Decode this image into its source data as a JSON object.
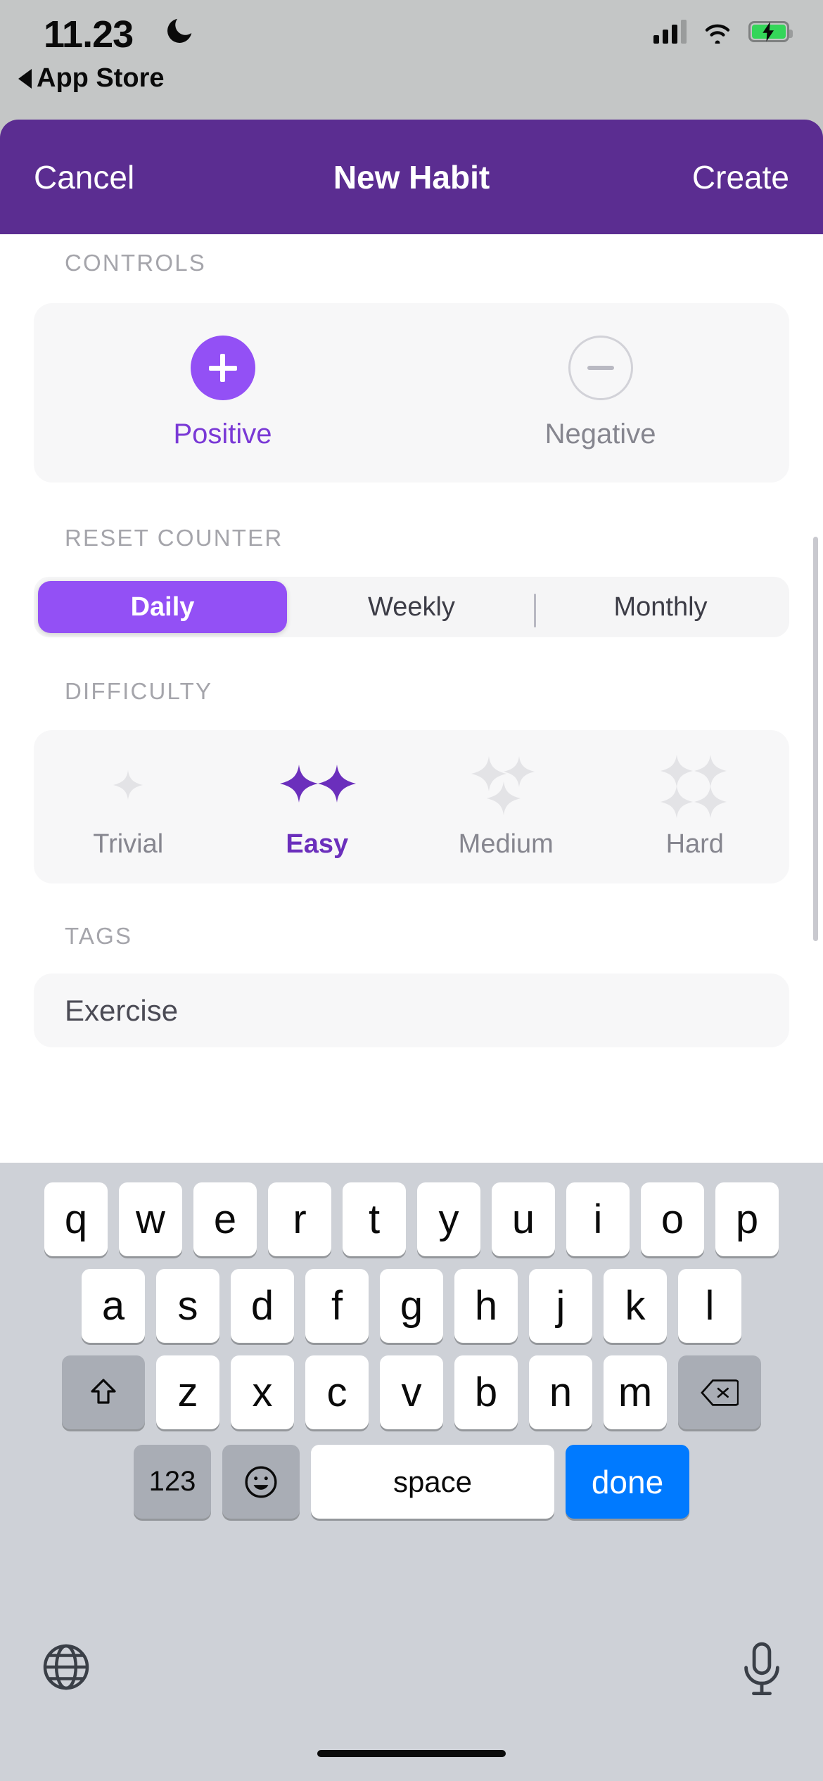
{
  "status_bar": {
    "time": "11.23",
    "dnd_icon": "moon-icon",
    "back_label": "App Store",
    "signal_icon": "cellular-signal-icon",
    "wifi_icon": "wifi-icon",
    "battery_icon": "battery-charging-icon"
  },
  "nav": {
    "cancel_label": "Cancel",
    "title": "New Habit",
    "create_label": "Create",
    "bar_color": "#5B2D91"
  },
  "sections": {
    "controls": {
      "header": "CONTROLS",
      "options": [
        {
          "label": "Positive",
          "icon": "plus-circle-icon",
          "selected": true
        },
        {
          "label": "Negative",
          "icon": "minus-circle-icon",
          "selected": false
        }
      ]
    },
    "reset_counter": {
      "header": "RESET COUNTER",
      "options": [
        "Daily",
        "Weekly",
        "Monthly"
      ],
      "selected": "Daily"
    },
    "difficulty": {
      "header": "DIFFICULTY",
      "options": [
        {
          "label": "Trivial",
          "stars": 1,
          "selected": false
        },
        {
          "label": "Easy",
          "stars": 2,
          "selected": true
        },
        {
          "label": "Medium",
          "stars": 3,
          "selected": false
        },
        {
          "label": "Hard",
          "stars": 4,
          "selected": false
        }
      ]
    },
    "tags": {
      "header": "TAGS",
      "value": "Exercise"
    }
  },
  "colors": {
    "accent_purple": "#9350F5",
    "deep_purple": "#5B2D91",
    "selected_text": "#6B2FBC",
    "muted_gray": "#A5A5AB",
    "keyboard_bg": "#CED1D7",
    "done_blue": "#007AFF"
  },
  "keyboard": {
    "row1": [
      "q",
      "w",
      "e",
      "r",
      "t",
      "y",
      "u",
      "i",
      "o",
      "p"
    ],
    "row2": [
      "a",
      "s",
      "d",
      "f",
      "g",
      "h",
      "j",
      "k",
      "l"
    ],
    "row3_letters": [
      "z",
      "x",
      "c",
      "v",
      "b",
      "n",
      "m"
    ],
    "shift_icon": "shift-up-arrow-icon",
    "backspace_icon": "backspace-delete-icon",
    "numbers_label": "123",
    "emoji_icon": "smiley-emoji-icon",
    "space_label": "space",
    "done_label": "done",
    "globe_icon": "globe-language-icon",
    "mic_icon": "microphone-dictation-icon"
  }
}
